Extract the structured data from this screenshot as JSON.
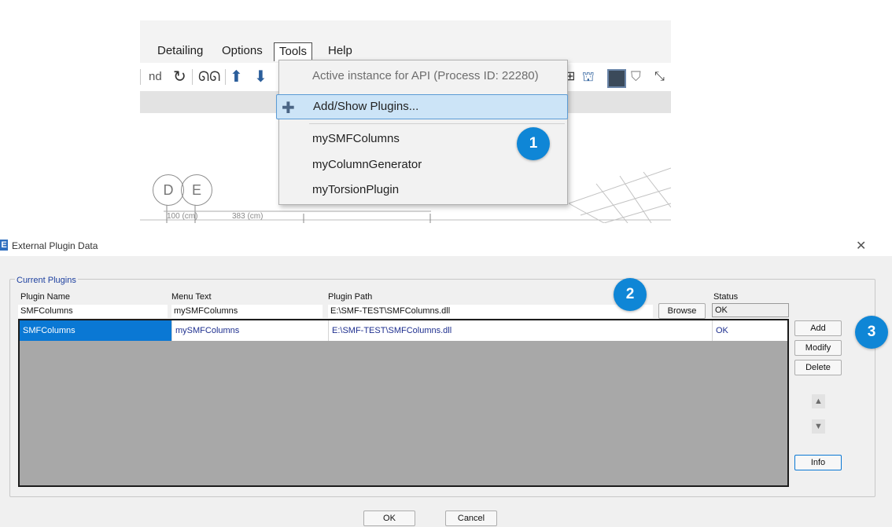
{
  "menubar": {
    "items": [
      "Detailing",
      "Options",
      "Tools",
      "Help"
    ],
    "active": "Tools"
  },
  "toolbar": {
    "partial_label": "nd"
  },
  "canvas": {
    "grid_labels": [
      "D",
      "E"
    ],
    "dims": [
      "100 (cm)",
      "383 (cm)"
    ]
  },
  "tools_menu": {
    "items": [
      {
        "label": "Active instance for API (Process ID: 22280)",
        "disabled": true
      },
      {
        "label": "Add/Show Plugins...",
        "highlighted": true,
        "icon": "puzzle-icon"
      },
      {
        "label": "mySMFColumns"
      },
      {
        "label": "myColumnGenerator"
      },
      {
        "label": "myTorsionPlugin"
      }
    ]
  },
  "callouts": [
    "1",
    "2",
    "3"
  ],
  "dialog": {
    "app_icon": "E",
    "title": "External Plugin Data",
    "close": "✕",
    "group_label": "Current Plugins",
    "columns": [
      "Plugin Name",
      "Menu Text",
      "Plugin Path",
      "Status"
    ],
    "edit_row": {
      "plugin_name": "SMFColumns",
      "menu_text": "mySMFColumns",
      "plugin_path": "E:\\SMF-TEST\\SMFColumns.dll",
      "status": "OK"
    },
    "browse_label": "Browse",
    "rows": [
      {
        "plugin_name": "SMFColumns",
        "menu_text": "mySMFColumns",
        "plugin_path": "E:\\SMF-TEST\\SMFColumns.dll",
        "status": "OK"
      }
    ],
    "side_buttons": {
      "add": "Add",
      "modify": "Modify",
      "delete": "Delete",
      "info": "Info"
    },
    "move_up": "▲",
    "move_down": "▼",
    "ok_label": "OK",
    "cancel_label": "Cancel"
  },
  "colors": {
    "accent": "#0a78d4",
    "callout": "#0f86d6",
    "menu_highlight": "#cce4f7",
    "grid_background": "#a8a8a8"
  }
}
